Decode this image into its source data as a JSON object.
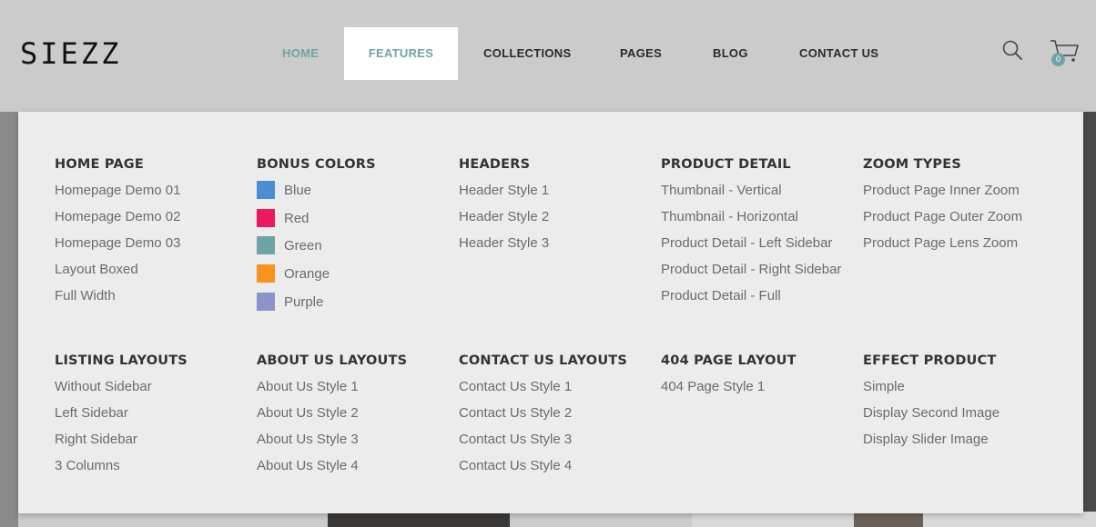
{
  "logo": "SIEZZ",
  "nav": [
    {
      "label": "HOME"
    },
    {
      "label": "FEATURES"
    },
    {
      "label": "COLLECTIONS"
    },
    {
      "label": "PAGES"
    },
    {
      "label": "BLOG"
    },
    {
      "label": "CONTACT US"
    }
  ],
  "cart": {
    "count": "0"
  },
  "colors": {
    "accent": "#6fa3a6",
    "menu_bg": "#ececec",
    "header_bg": "#cbcbcb"
  },
  "menu": {
    "home_page": {
      "title": "HOME PAGE",
      "items": [
        "Homepage Demo 01",
        "Homepage Demo 02",
        "Homepage Demo 03",
        "Layout Boxed",
        "Full Width"
      ]
    },
    "bonus_colors": {
      "title": "BONUS COLORS",
      "items": [
        {
          "label": "Blue",
          "color": "#4a8fd4"
        },
        {
          "label": "Red",
          "color": "#ec1861"
        },
        {
          "label": "Green",
          "color": "#6fa3a6"
        },
        {
          "label": "Orange",
          "color": "#f7931e"
        },
        {
          "label": "Purple",
          "color": "#8b93c9"
        }
      ]
    },
    "headers": {
      "title": "HEADERS",
      "items": [
        "Header Style 1",
        "Header Style 2",
        "Header Style 3"
      ]
    },
    "product_detail": {
      "title": "PRODUCT DETAIL",
      "items": [
        "Thumbnail - Vertical",
        "Thumbnail - Horizontal",
        "Product Detail - Left Sidebar",
        "Product Detail - Right Sidebar",
        "Product Detail - Full"
      ]
    },
    "zoom_types": {
      "title": "ZOOM TYPES",
      "items": [
        "Product Page Inner Zoom",
        "Product Page Outer Zoom",
        "Product Page Lens Zoom"
      ]
    },
    "listing_layouts": {
      "title": "LISTING LAYOUTS",
      "items": [
        "Without Sidebar",
        "Left Sidebar",
        "Right Sidebar",
        "3 Columns"
      ]
    },
    "about_us_layouts": {
      "title": "ABOUT US LAYOUTS",
      "items": [
        "About Us Style 1",
        "About Us Style 2",
        "About Us Style 3",
        "About Us Style 4"
      ]
    },
    "contact_us_layouts": {
      "title": "CONTACT US LAYOUTS",
      "items": [
        "Contact Us Style 1",
        "Contact Us Style 2",
        "Contact Us Style 3",
        "Contact Us Style 4"
      ]
    },
    "page_404_layout": {
      "title": "404 PAGE LAYOUT",
      "items": [
        "404 Page Style 1"
      ]
    },
    "effect_product": {
      "title": "EFFECT PRODUCT",
      "items": [
        "Simple",
        "Display Second Image",
        "Display Slider Image"
      ]
    }
  }
}
